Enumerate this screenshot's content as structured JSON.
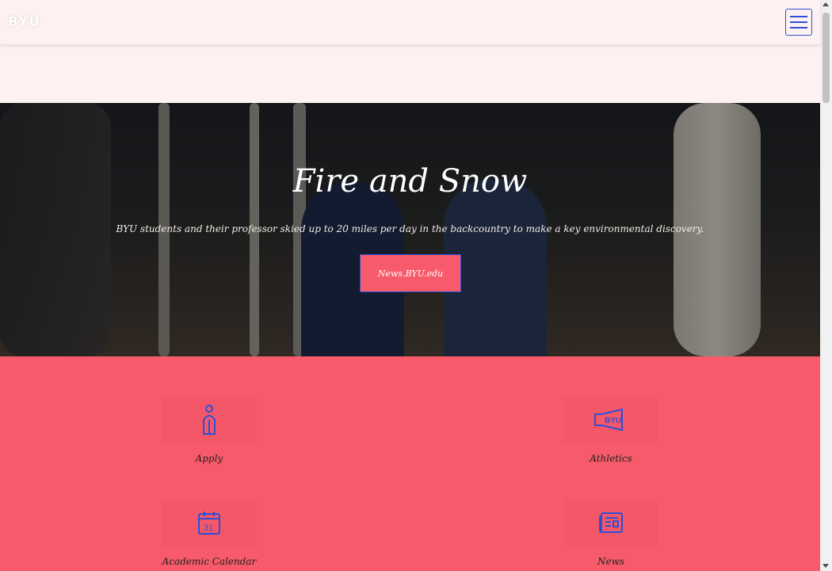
{
  "header": {
    "logo_text": "BYU",
    "menu_icon": "hamburger-menu-icon"
  },
  "hero": {
    "title": "Fire and Snow",
    "subtitle": "BYU students and their professor skied up to 20 miles per day in the backcountry to make a key environmental discovery.",
    "button_label": "News.BYU.edu"
  },
  "quick_links": [
    {
      "label": "Apply",
      "icon": "graduate-icon"
    },
    {
      "label": "Athletics",
      "icon": "megaphone-byu-icon"
    },
    {
      "label": "Academic Calendar",
      "icon": "calendar-icon",
      "icon_text": "31"
    },
    {
      "label": "News",
      "icon": "newspaper-icon"
    }
  ],
  "colors": {
    "accent": "#f75a6a",
    "link_blue": "#2d4fd6",
    "header_bg": "#fdf2f1"
  }
}
